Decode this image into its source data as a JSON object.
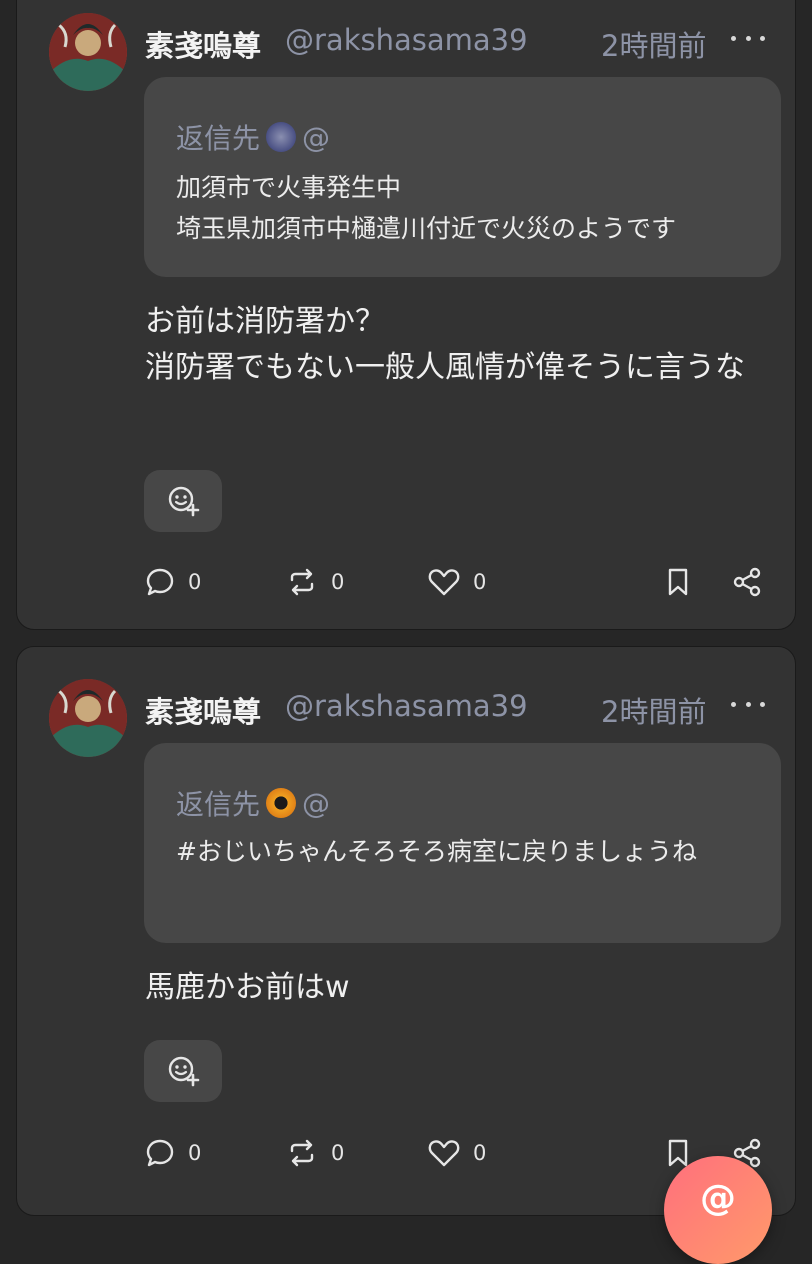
{
  "posts": [
    {
      "author_name": "素戔嗚尊",
      "author_handle": "@rakshasama39",
      "time": "2時間前",
      "reply_prefix": "返信先",
      "reply_target_handle": "@",
      "quote_lines": [
        "加須市で火事発生中",
        "埼玉県加須市中樋遣川付近で火災のようです"
      ],
      "body": "お前は消防署か？\n消防署でもない一般人風情が偉そうに言うな",
      "replies": "0",
      "renotes": "0",
      "likes": "0"
    },
    {
      "author_name": "素戔嗚尊",
      "author_handle": "@rakshasama39",
      "time": "2時間前",
      "reply_prefix": "返信先",
      "reply_target_handle": "@",
      "quote_lines": [
        "#おじいちゃんそろそろ病室に戻りましょうね"
      ],
      "body": "馬鹿かお前はw",
      "replies": "0",
      "renotes": "0",
      "likes": "0"
    }
  ],
  "colors": {
    "background": "#262626",
    "card": "#333333",
    "quote": "#474747",
    "muted": "#8d93a6",
    "accent_gradient_start": "#ff6f7d",
    "accent_gradient_end": "#ff9a6a"
  },
  "icons": {
    "more": "more-horizontal-icon",
    "reaction_add": "emoji-plus-icon",
    "reply": "comment-icon",
    "renote": "repeat-icon",
    "like": "heart-icon",
    "bookmark": "bookmark-icon",
    "share": "share-icon",
    "compose": "compose-icon"
  },
  "fab_glyph": "@"
}
